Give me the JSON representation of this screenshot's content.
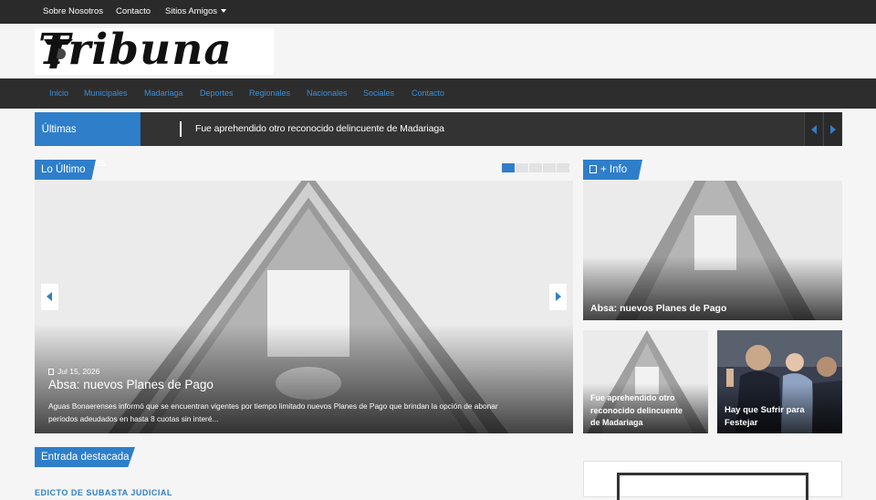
{
  "topbar": {
    "links": [
      "Sobre Nosotros",
      "Contacto",
      "Sitios Amigos"
    ]
  },
  "logo": {
    "text": "Tribuna"
  },
  "nav": {
    "items": [
      "Inicio",
      "Municipales",
      "Madariaga",
      "Deportes",
      "Regionales",
      "Nacionales",
      "Sociales",
      "Contacto"
    ]
  },
  "ticker": {
    "label": "Últimas Publicaciones",
    "headline": "Fue aprehendido otro reconocido delincuente de Madariaga"
  },
  "latest": {
    "tag": "Lo Último",
    "slide_count": 5,
    "active_slide": 1,
    "slide": {
      "date": "Jul 15, 2026",
      "title": "Absa: nuevos Planes de Pago",
      "excerpt_line1": " Aguas Bonaerenses informó que se encuentran vigentes por tiempo limitado nuevos Planes de Pago que brindan la opción de abonar",
      "excerpt_line2": "períodos adeudados en hasta 8 cuotas sin interé..."
    }
  },
  "info": {
    "tag": "+ Info",
    "cards": [
      {
        "title": "Absa: nuevos Planes de Pago"
      },
      {
        "title_line1": "Fue aprehendido otro",
        "title_line2": "reconocido delincuente",
        "title_line3": "de Madariaga"
      },
      {
        "title_line1": "Hay que Sufrir para",
        "title_line2": "Festejar"
      }
    ]
  },
  "featured": {
    "tag": "Entrada destacada",
    "first_title": "EDICTO DE SUBASTA JUDICIAL"
  },
  "colors": {
    "accent": "#2f7ec9",
    "topbar": "#2a2a2a",
    "navbar": "#2d2d2d"
  }
}
